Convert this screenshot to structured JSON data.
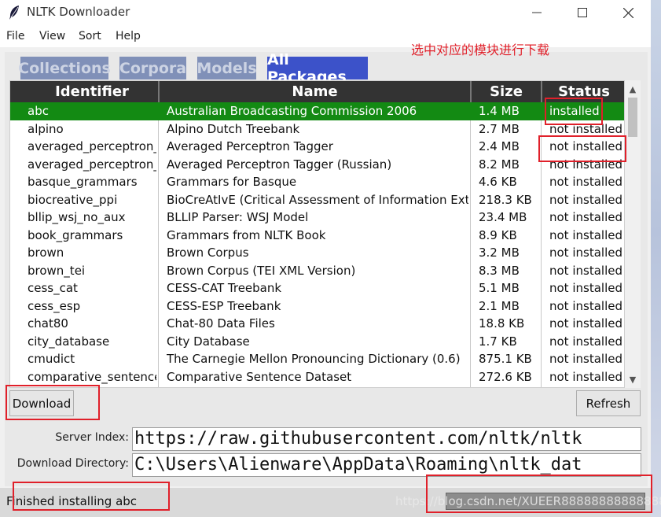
{
  "window": {
    "title": "NLTK Downloader",
    "icon": "feather-icon"
  },
  "menu": [
    "File",
    "View",
    "Sort",
    "Help"
  ],
  "annotation": "选中对应的模块进行下载",
  "tabs": [
    {
      "label": "Collections",
      "active": false
    },
    {
      "label": "Corpora",
      "active": false
    },
    {
      "label": "Models",
      "active": false
    },
    {
      "label": "All Packages",
      "active": true
    }
  ],
  "table": {
    "headers": [
      "Identifier",
      "Name",
      "Size",
      "Status"
    ],
    "rows": [
      {
        "id": "abc",
        "name": "Australian Broadcasting Commission 2006",
        "size": "1.4 MB",
        "status": "installed",
        "selected": true
      },
      {
        "id": "alpino",
        "name": "Alpino Dutch Treebank",
        "size": "2.7 MB",
        "status": "not installed"
      },
      {
        "id": "averaged_perceptron_t",
        "name": "Averaged Perceptron Tagger",
        "size": "2.4 MB",
        "status": "not installed"
      },
      {
        "id": "averaged_perceptron_t",
        "name": "Averaged Perceptron Tagger (Russian)",
        "size": "8.2 MB",
        "status": "not installed"
      },
      {
        "id": "basque_grammars",
        "name": "Grammars for Basque",
        "size": "4.6 KB",
        "status": "not installed"
      },
      {
        "id": "biocreative_ppi",
        "name": "BioCreAtIvE (Critical Assessment of Information Extra",
        "size": "218.3 KB",
        "status": "not installed"
      },
      {
        "id": "bllip_wsj_no_aux",
        "name": "BLLIP Parser: WSJ Model",
        "size": "23.4 MB",
        "status": "not installed"
      },
      {
        "id": "book_grammars",
        "name": "Grammars from NLTK Book",
        "size": "8.9 KB",
        "status": "not installed"
      },
      {
        "id": "brown",
        "name": "Brown Corpus",
        "size": "3.2 MB",
        "status": "not installed"
      },
      {
        "id": "brown_tei",
        "name": "Brown Corpus (TEI XML Version)",
        "size": "8.3 MB",
        "status": "not installed"
      },
      {
        "id": "cess_cat",
        "name": "CESS-CAT Treebank",
        "size": "5.1 MB",
        "status": "not installed"
      },
      {
        "id": "cess_esp",
        "name": "CESS-ESP Treebank",
        "size": "2.1 MB",
        "status": "not installed"
      },
      {
        "id": "chat80",
        "name": "Chat-80 Data Files",
        "size": "18.8 KB",
        "status": "not installed"
      },
      {
        "id": "city_database",
        "name": "City Database",
        "size": "1.7 KB",
        "status": "not installed"
      },
      {
        "id": "cmudict",
        "name": "The Carnegie Mellon Pronouncing Dictionary (0.6)",
        "size": "875.1 KB",
        "status": "not installed"
      },
      {
        "id": "comparative_sentences",
        "name": "Comparative Sentence Dataset",
        "size": "272.6 KB",
        "status": "not installed"
      }
    ]
  },
  "buttons": {
    "download": "Download",
    "refresh": "Refresh"
  },
  "server_index": {
    "label": "Server Index:",
    "value": "https://raw.githubusercontent.com/nltk/nltk"
  },
  "download_directory": {
    "label": "Download Directory:",
    "value": "C:\\Users\\Alienware\\AppData\\Roaming\\nltk_dat"
  },
  "status": {
    "text": "Finished installing abc"
  },
  "watermark": "https://blog.csdn.net/XUEER88888888888888",
  "colors": {
    "selected_row": "#138a13",
    "active_tab": "#3c52c9",
    "annotation": "#e0202a"
  }
}
